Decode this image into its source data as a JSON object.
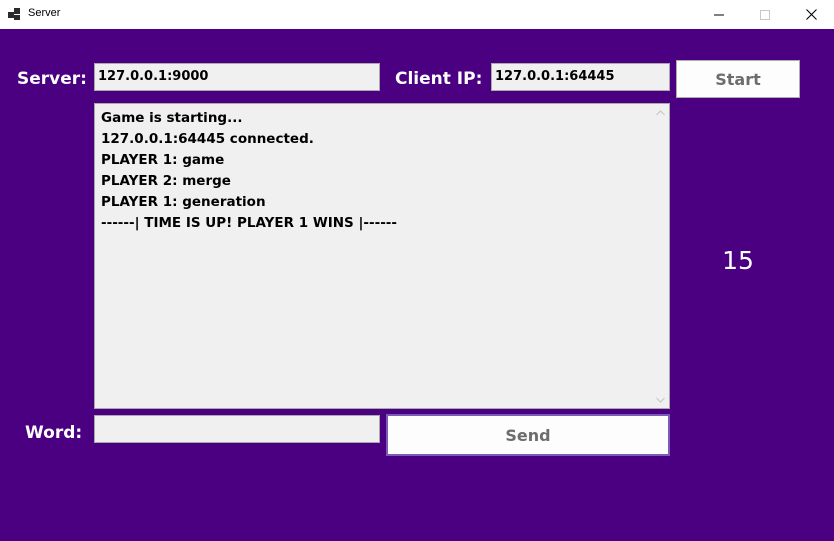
{
  "window": {
    "title": "Server",
    "minimize_icon": "minimize-icon",
    "maximize_icon": "maximize-icon",
    "close_icon": "close-icon"
  },
  "colors": {
    "background": "#4b0082",
    "label_text": "#ffffff",
    "field_background": "#f0f0f0",
    "button_text": "#6d6d6d"
  },
  "server": {
    "label": "Server:",
    "value": "127.0.0.1:9000"
  },
  "client": {
    "label": "Client IP:",
    "value": "127.0.0.1:64445"
  },
  "start_button": {
    "label": "Start"
  },
  "log": {
    "lines": [
      "Game is starting...",
      "127.0.0.1:64445 connected.",
      "PLAYER 1: game",
      "PLAYER 2: merge",
      "PLAYER 1: generation",
      "------| TIME IS UP! PLAYER 1 WINS |------"
    ]
  },
  "timer": {
    "value": "15"
  },
  "word": {
    "label": "Word:",
    "value": ""
  },
  "send_button": {
    "label": "Send"
  }
}
